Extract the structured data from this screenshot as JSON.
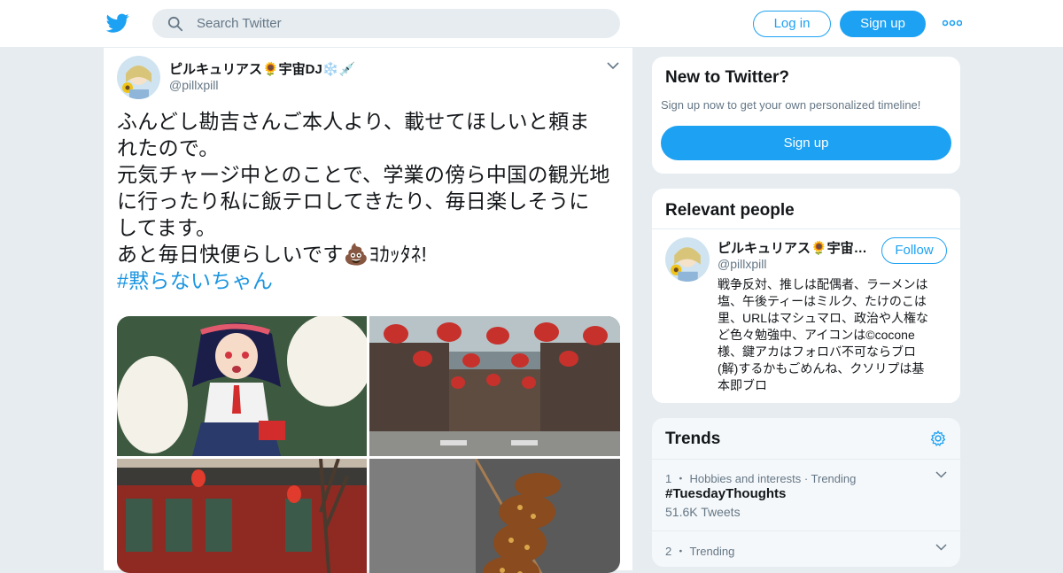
{
  "header": {
    "logo_icon": "twitter-bird-icon",
    "search": {
      "placeholder": "Search Twitter",
      "icon": "search-icon"
    },
    "login_label": "Log in",
    "signup_label": "Sign up",
    "more_icon": "more-dots-icon"
  },
  "tweet": {
    "author_name": "ピルキュリアス🌻宇宙DJ❄️💉",
    "author_handle": "@pillxpill",
    "text_lines": [
      "ふんどし勘吉さんご本人より、載せてほしいと頼ま",
      "れたので。",
      "元気チャージ中とのことで、学業の傍ら中国の観光地",
      "に行ったり私に飯テロしてきたり、毎日楽しそうに",
      "してます。",
      "あと毎日快便らしいです💩ﾖｶｯﾀﾈ!"
    ],
    "hashtag": "#黙らないちゃん",
    "media_count": 4
  },
  "sidebar": {
    "new_to_twitter": {
      "title": "New to Twitter?",
      "subtitle": "Sign up now to get your own personalized timeline!",
      "signup_label": "Sign up"
    },
    "relevant_people": {
      "title": "Relevant people",
      "person": {
        "name": "ピルキュリアス🌻宇宙DJ❄️💉",
        "handle": "@pillxpill",
        "follow_label": "Follow",
        "bio_lines": [
          "戦争反対、推しは配偶者、ラーメンは",
          "塩、午後ティーはミルク、たけのこは",
          "里、URLはマシュマロ、政治や人権な",
          "ど色々勉強中、アイコンは©cocone",
          "様、鍵アカはフォロバ不可ならブロ",
          "(解)するかもごめんね、クソリプは基",
          "本即ブロ"
        ]
      }
    },
    "trends": {
      "title": "Trends",
      "items": [
        {
          "rank": "1",
          "meta": "Hobbies and interests · Trending",
          "tag": "#TuesdayThoughts",
          "count": "51.6K Tweets"
        },
        {
          "rank": "2",
          "meta": "Trending",
          "tag": "",
          "count": ""
        }
      ]
    }
  },
  "colors": {
    "brand_blue": "#1da1f2",
    "link_blue": "#1b95e0",
    "background": "#e6ecf0",
    "secondary_text": "#657786"
  }
}
